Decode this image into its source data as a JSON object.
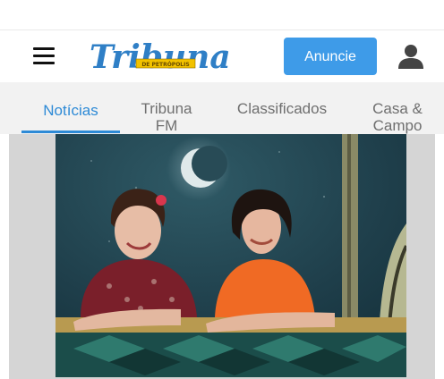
{
  "header": {
    "menu_icon": "hamburger-menu-icon",
    "logo_text": "Tribuna",
    "logo_subtext": "DE PETRÓPOLIS",
    "anuncie_label": "Anuncie",
    "user_icon": "user-icon",
    "accent_color": "#3e9be8"
  },
  "tabs": [
    {
      "label": "Notícias",
      "active": true
    },
    {
      "label": "Tribuna FM",
      "active": false
    },
    {
      "label": "Classificados",
      "active": false
    },
    {
      "label": "Casa & Campo",
      "active": false
    }
  ],
  "tab_labels": {
    "t0": "Notícias",
    "t1_line1": "Tribuna",
    "t1_line2": "FM",
    "t2": "Classificados",
    "t3_line1": "Casa &",
    "t3_line2": "Campo"
  },
  "colors": {
    "active_tab": "#2d8ad6",
    "inactive_tab": "#6f6f6f",
    "tab_bar_bg": "#f2f2f2"
  },
  "article": {
    "image_description_icon": "news-photo-image"
  }
}
